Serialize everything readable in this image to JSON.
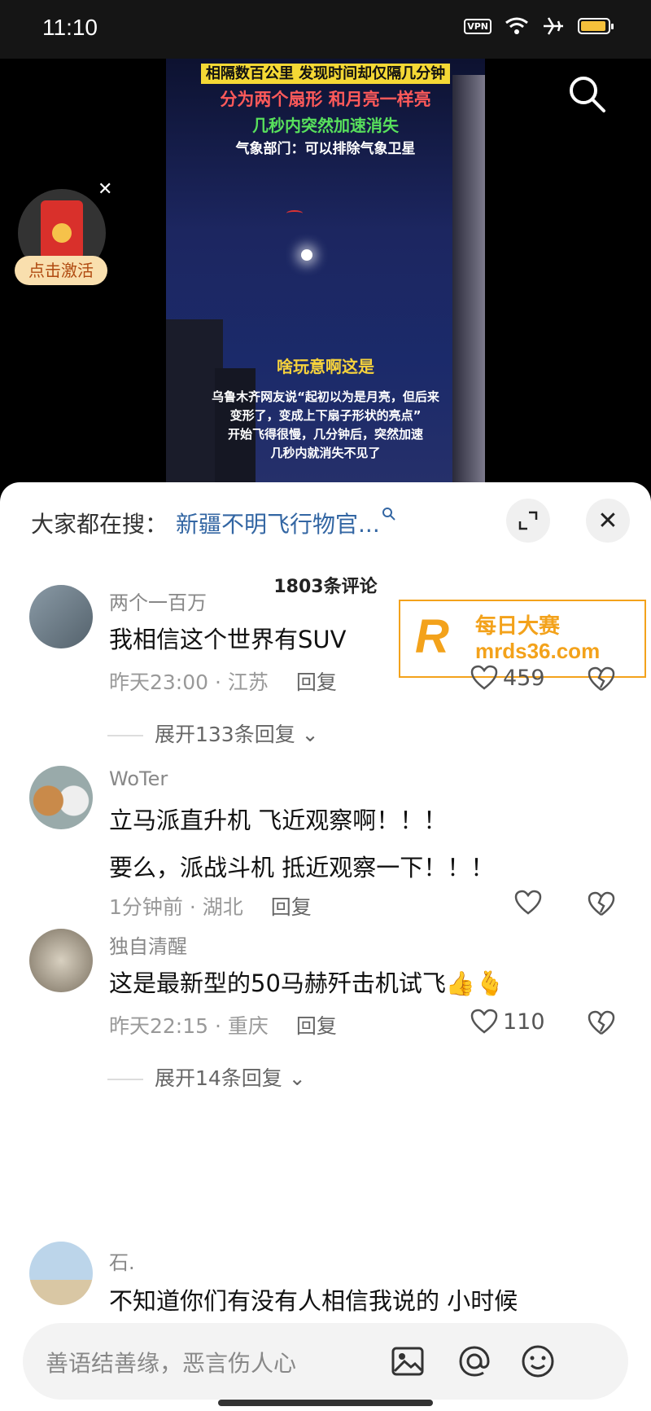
{
  "status": {
    "time": "11:10",
    "vpn": "VPN"
  },
  "video": {
    "caption_line1": "相隔数百公里 发现时间却仅隔几分钟",
    "caption_line2": "分为两个扇形 和月亮一样亮",
    "caption_line3": "几秒内突然加速消失",
    "caption_line4": "气象部门：可以排除气象卫星",
    "caption_line5": "啥玩意啊这是",
    "caption_line6": "乌鲁木齐网友说“起初以为是月亮，但后来",
    "caption_line7": "变形了，变成上下扇子形状的亮点”",
    "caption_line8": "开始飞得很慢，几分钟后，突然加速",
    "caption_line9": "几秒内就消失不见了"
  },
  "redpacket": {
    "label": "点击激活"
  },
  "sheet": {
    "search_prefix": "大家都在搜：",
    "search_link": "新疆不明飞行物官...",
    "comment_count": "1803条评论"
  },
  "ad": {
    "line1": "每日大赛",
    "line2": "mrds36.com",
    "logo": "R"
  },
  "comments": [
    {
      "user": "两个一百万",
      "text": "我相信这个世界有SUV",
      "time": "昨天23:00 · 江苏",
      "reply": "回复",
      "likes": "459",
      "expand": "展开133条回复"
    },
    {
      "user": "WoTer",
      "text": "立马派直升机  飞近观察啊！！！",
      "text2": "要么，派战斗机  抵近观察一下！！！",
      "time": "1分钟前 · 湖北",
      "reply": "回复",
      "likes": ""
    },
    {
      "user": "独自清醒",
      "text": "这是最新型的50马赫歼击机试飞👍🫰",
      "time": "昨天22:15 · 重庆",
      "reply": "回复",
      "likes": "110",
      "expand": "展开14条回复"
    },
    {
      "user": "石.",
      "text": "不知道你们有没有人相信我说的        小时候"
    }
  ],
  "input": {
    "placeholder": "善语结善缘，恶言伤人心"
  }
}
